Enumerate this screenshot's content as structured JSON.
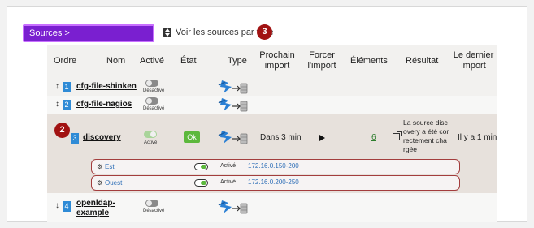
{
  "toolbar": {
    "sources_button": "Sources >",
    "type_toggle_label": "Voir les sources par type"
  },
  "callouts": [
    "2",
    "3"
  ],
  "columns": [
    "Ordre",
    "Nom",
    "Activé",
    "État",
    "Type",
    "Prochain import",
    "Forcer l'import",
    "Éléments",
    "Résultat",
    "Le dernier import"
  ],
  "column_lines": {
    "prochain": [
      "Prochain",
      "import"
    ],
    "forcer": [
      "Forcer",
      "l'import"
    ],
    "dernier": [
      "Le dernier",
      "import"
    ]
  },
  "rows": [
    {
      "order": "1",
      "name": "cfg-file-shinken",
      "enabled_label": "Désactivé"
    },
    {
      "order": "2",
      "name": "cfg-file-nagios",
      "enabled_label": "Désactivé"
    },
    {
      "order": "3",
      "name": "discovery",
      "enabled_label": "Activé",
      "state": "Ok",
      "next_import": "Dans 3 min",
      "elements": "6",
      "result_lines": [
        "La source disc",
        "overy a été cor",
        "rectement cha",
        "rgée"
      ],
      "last_import": "Il y a 1 min"
    },
    {
      "order": "4",
      "name_lines": [
        "openldap-",
        "example"
      ],
      "enabled_label": "Désactivé"
    }
  ],
  "sub_rows": [
    {
      "label": "Est",
      "status": "Activé",
      "range": "172.16.0.150-200"
    },
    {
      "label": "Ouest",
      "status": "Activé",
      "range": "172.16.0.200-250"
    }
  ],
  "colors": {
    "accent_purple": "#7a1fd0",
    "ok_green": "#5cb83c",
    "callout_red": "#a11212",
    "order_blue": "#2f8bd6"
  }
}
